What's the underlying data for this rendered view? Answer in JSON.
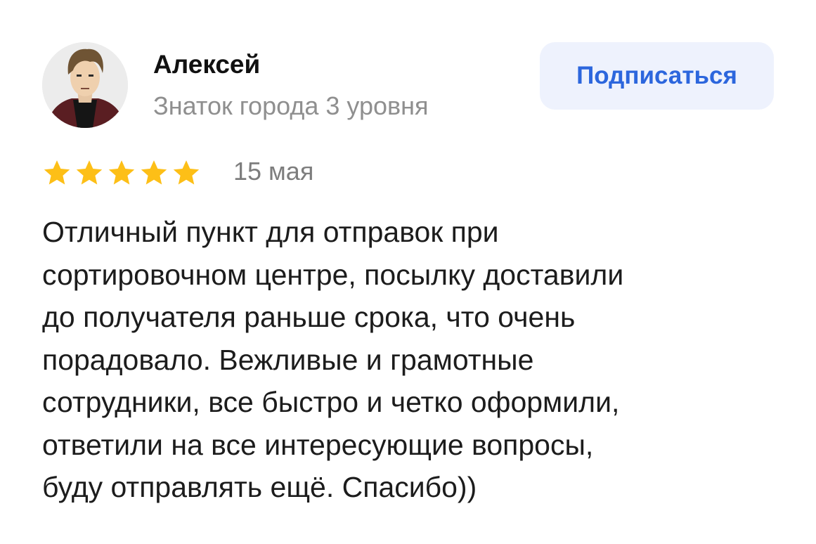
{
  "author": {
    "name": "Алексей",
    "level": "Знаток города 3 уровня"
  },
  "subscribe": {
    "label": "Подписаться"
  },
  "review": {
    "rating": 5,
    "rating_max": 5,
    "date": "15 мая",
    "lines": [
      "Отличный пункт для отправок при",
      "сортировочном центре, посылку доставили",
      "до получателя раньше срока, что очень",
      "порадовало. Вежливые и грамотные",
      "сотрудники, все быстро и четко оформили,",
      "ответили на все интересующие вопросы,",
      "буду отправлять ещё. Спасибо))"
    ]
  },
  "colors": {
    "star": "#fdbf17",
    "accent": "#2c66dd",
    "button_bg": "#eef2fd",
    "muted": "#8f8f8f"
  },
  "icons": {
    "avatar": "avatar-illustration",
    "rating": "star-icon"
  }
}
